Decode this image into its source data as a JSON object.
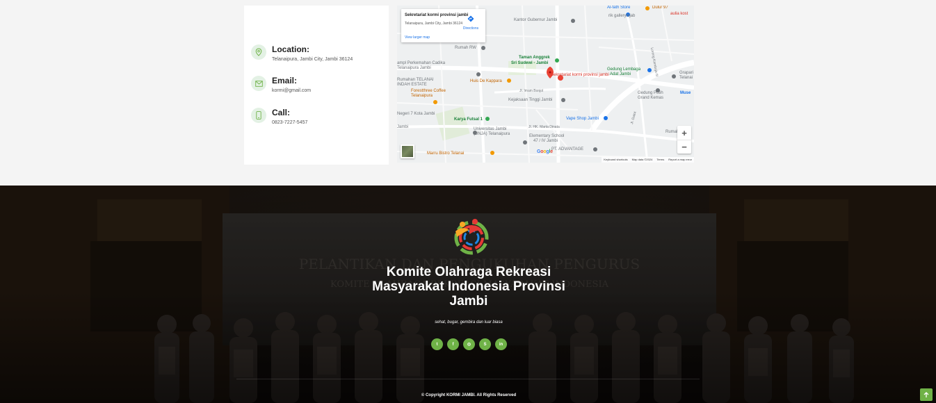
{
  "contact": {
    "location": {
      "title": "Location:",
      "value": "Telanaipura, Jambi City, Jambi 36124",
      "icon": "map-pin-icon"
    },
    "email": {
      "title": "Email:",
      "value": "kormi@gmail.com",
      "icon": "envelope-icon"
    },
    "call": {
      "title": "Call:",
      "value": "0823-7227-5457",
      "icon": "phone-icon"
    }
  },
  "map": {
    "card_title": "Sekretariat kormi provinsi jambi",
    "card_address": "Telanaipura, Jambi City, Jambi 36124",
    "directions_label": "Directions",
    "view_larger": "View larger map",
    "pin_label": "Sekretariat kormi provinsi jambi",
    "zoom_in": "+",
    "zoom_out": "−",
    "google": "Google",
    "footer": {
      "shortcuts": "Keyboard shortcuts",
      "data": "Map data ©2024",
      "terms": "Terms",
      "report": "Report a map error"
    },
    "labels": {
      "alfath": "Al-fath Store",
      "dulur": "Dulur 97",
      "aulia": "aulia kost",
      "galery": "rik galleryhijab",
      "kantor": "Kantor Gubernur Jambi",
      "rumah_rw": "Rumah RW",
      "taman": "Taman Anggrek",
      "taman2": "Sri Sudewi - Jambi",
      "perum1": "ampl Perkemahan Cadika",
      "perum2": "Telanaipura Jambi",
      "huis": "Huis De Kappara",
      "rumah2": "Rumahan TELANAI",
      "rumah3": "INDAH ESTATE",
      "forest1": "Forestthree Coffee",
      "forest2": "Telanaipura",
      "imam": "Jl. Imam Bonjol",
      "kejaksaan": "Kejaksaan Tinggi Jambi",
      "negeri": "Negeri 7 Kota Jambi",
      "karya": "Karya Futsal 1",
      "unja1": "Universitas Jambi",
      "unja2": "(UNJA) Telanaipura",
      "jalan_mb": "Jl. HK. Marta Dinata",
      "vape": "Vape Shop Jambi",
      "elem1": "Elementary School",
      "elem2": "47 / IV Jambi",
      "advantage": "PT. ADVANTAGE",
      "marru": "Marru Bistro Telanai",
      "gedung1": "Gedung Lembaga",
      "gedung2": "Adat Jambi",
      "putih1": "Gedung Putih",
      "putih2": "Grand Kemas",
      "grapari": "Grapari",
      "telanai_r": "Telanai",
      "muse": "Muse",
      "rumah_r": "Rumah 042 I",
      "jambi_l": "Jambi",
      "lorong": "Lorong Kamboja III",
      "jl_gatot": "Jl. Gatot"
    }
  },
  "footer": {
    "title": "Komite Olahraga Rekreasi Masyarakat Indonesia Provinsi Jambi",
    "tagline": "sehat, bugar, gembira dan luar biasa",
    "copyright": "© Copyright KORMI JAMBI. All Rights Reserved",
    "banner_line1": "PELANTIKAN DAN PENGUKUHAN PENGURUS",
    "banner_line2": "KOMITE OLAHRAGA REKREASI MASYARAKAT INDONESIA",
    "socials": [
      {
        "name": "twitter-icon",
        "glyph": "t"
      },
      {
        "name": "facebook-icon",
        "glyph": "f"
      },
      {
        "name": "instagram-icon",
        "glyph": "◎"
      },
      {
        "name": "skype-icon",
        "glyph": "S"
      },
      {
        "name": "linkedin-icon",
        "glyph": "in"
      }
    ]
  },
  "colors": {
    "accent": "#6fb247",
    "map_pin": "#ea4335",
    "link": "#1a73e8"
  }
}
